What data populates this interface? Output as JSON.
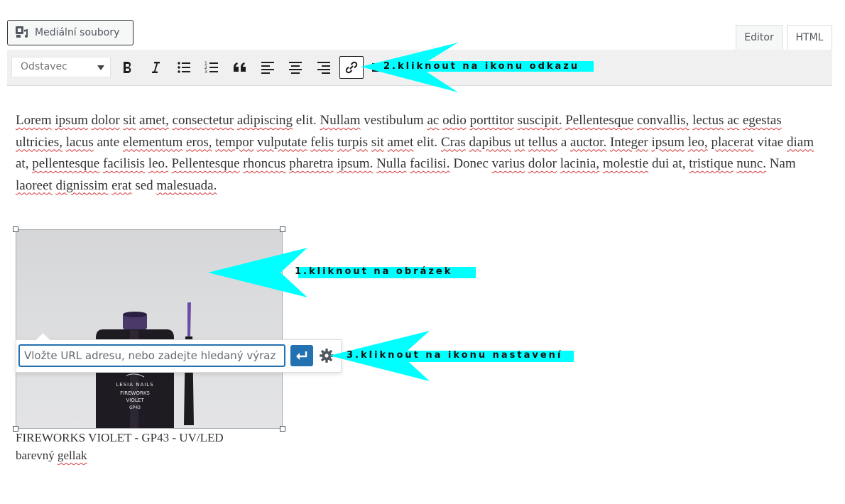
{
  "media_button": {
    "label": "Mediální soubory",
    "icon": "media-icon"
  },
  "tabs": [
    {
      "label": "Editor",
      "active": true
    },
    {
      "label": "HTML",
      "active": false
    }
  ],
  "toolbar": {
    "format_select": "Odstavec",
    "buttons": [
      {
        "name": "bold",
        "icon": "bold-icon"
      },
      {
        "name": "italic",
        "icon": "italic-icon"
      },
      {
        "name": "bulleted-list",
        "icon": "bulleted-list-icon"
      },
      {
        "name": "numbered-list",
        "icon": "numbered-list-icon"
      },
      {
        "name": "blockquote",
        "icon": "quote-icon"
      },
      {
        "name": "align-left",
        "icon": "align-left-icon"
      },
      {
        "name": "align-center",
        "icon": "align-center-icon"
      },
      {
        "name": "align-right",
        "icon": "align-right-icon"
      },
      {
        "name": "insert-link",
        "icon": "link-icon",
        "active": true
      }
    ]
  },
  "content": {
    "paragraph": [
      [
        "Lorem",
        true
      ],
      [
        "ipsum",
        true
      ],
      [
        "dolor",
        true
      ],
      [
        "sit",
        true
      ],
      [
        "amet,",
        true
      ],
      [
        "consectetur",
        true
      ],
      [
        "adipiscing",
        true
      ],
      [
        "elit.",
        false
      ],
      [
        "Nullam",
        true
      ],
      [
        "vestibulum",
        false
      ],
      [
        "ac",
        true
      ],
      [
        "odio",
        true
      ],
      [
        "porttitor",
        true
      ],
      [
        "suscipit.",
        true
      ],
      [
        "Pellentesque",
        true
      ],
      [
        "convallis,",
        true
      ],
      [
        "lectus",
        true
      ],
      [
        "ac",
        true
      ],
      [
        "egestas",
        true
      ],
      [
        "ultricies,",
        true
      ],
      [
        "lacus",
        true
      ],
      [
        "ante",
        false
      ],
      [
        "elementum",
        true
      ],
      [
        "eros,",
        true
      ],
      [
        "tempor",
        true
      ],
      [
        "vulputate",
        true
      ],
      [
        "felis",
        true
      ],
      [
        "turpis",
        true
      ],
      [
        "sit",
        true
      ],
      [
        "amet",
        true
      ],
      [
        "elit.",
        false
      ],
      [
        "Cras",
        true
      ],
      [
        "dapibus",
        true
      ],
      [
        "ut",
        true
      ],
      [
        "tellus",
        true
      ],
      [
        "a",
        false
      ],
      [
        "auctor.",
        true
      ],
      [
        "Integer",
        true
      ],
      [
        "ipsum",
        true
      ],
      [
        "leo,",
        true
      ],
      [
        "placerat",
        true
      ],
      [
        "vitae",
        false
      ],
      [
        "diam",
        true
      ],
      [
        "at,",
        false
      ],
      [
        "pellentesque",
        true
      ],
      [
        "facilisis",
        true
      ],
      [
        "leo.",
        true
      ],
      [
        "Pellentesque",
        true
      ],
      [
        "rhoncus",
        true
      ],
      [
        "pharetra",
        true
      ],
      [
        "ipsum.",
        true
      ],
      [
        "Nulla",
        true
      ],
      [
        "facilisi.",
        true
      ],
      [
        "Donec",
        false
      ],
      [
        "varius",
        true
      ],
      [
        "dolor",
        true
      ],
      [
        "lacinia,",
        true
      ],
      [
        "molestie",
        true
      ],
      [
        "dui",
        false
      ],
      [
        "at,",
        false
      ],
      [
        "tristique",
        true
      ],
      [
        "nunc.",
        true
      ],
      [
        "Nam",
        false
      ],
      [
        "laoreet",
        true
      ],
      [
        "dignissim",
        true
      ],
      [
        "erat",
        true
      ],
      [
        "sed",
        false
      ],
      [
        "malesuada.",
        true
      ]
    ],
    "image": {
      "alt": "Nail polish bottle FIREWORKS VIOLET",
      "bottle_text": [
        "LESIA NAILS",
        "FIREWORKS",
        "VIOLET",
        "GP43"
      ],
      "caption_line1": "FIREWORKS VIOLET - GP43 - UV/LED",
      "caption_line2_word1": "barevný",
      "caption_line2_word2": "gellak"
    }
  },
  "link_popover": {
    "placeholder": "Vložte URL adresu, nebo zadejte hledaný výraz",
    "apply_icon": "enter-icon",
    "settings_icon": "gear-icon"
  },
  "annotations": {
    "step1": "1.kliknout na obrázek",
    "step2": "2.kliknout na ikonu odkazu",
    "step3": "3.kliknout na ikonu nastavení",
    "arrow_color": "#00ffff"
  }
}
